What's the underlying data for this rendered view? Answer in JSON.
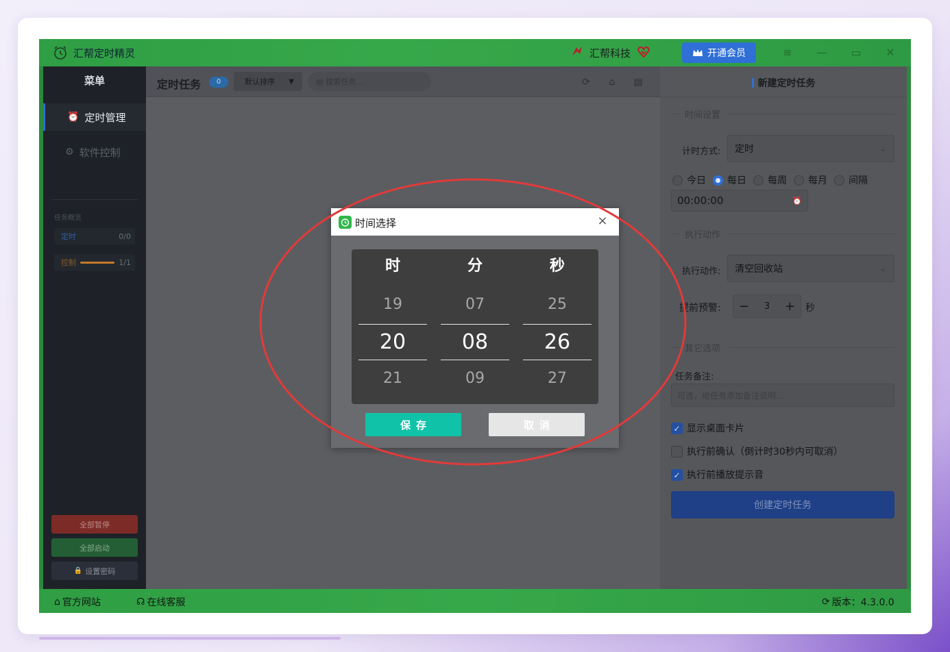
{
  "app": {
    "title": "汇帮定时精灵",
    "brand": "汇帮科技",
    "vip_label": "开通会员",
    "accent": "#2f6fd6",
    "titlebar_color": "#2f9e44"
  },
  "sidebar": {
    "menu_title": "菜单",
    "items": [
      {
        "label": "定时管理",
        "icon": "alarm-clock-icon",
        "active": true
      },
      {
        "label": "软件控制",
        "icon": "gear-icon",
        "active": false
      }
    ],
    "overview_title": "任务概览",
    "stats": [
      {
        "label": "定时",
        "value": "0/0",
        "color": "#2f6fd6"
      },
      {
        "label": "控制",
        "value": "1/1",
        "color": "#c77a2a"
      }
    ],
    "buttons": {
      "pause_all": "全部暂停",
      "start_all": "全部启动",
      "set_password": "设置密码"
    }
  },
  "middle": {
    "title": "定时任务",
    "count": "0",
    "sort_label": "默认排序",
    "search_placeholder": "搜索任务..."
  },
  "right": {
    "title": "新建定时任务",
    "time_section": "时间设置",
    "timing_mode_label": "计时方式:",
    "timing_mode_value": "定时",
    "radios": [
      {
        "label": "今日",
        "checked": false
      },
      {
        "label": "每日",
        "checked": true
      },
      {
        "label": "每周",
        "checked": false
      },
      {
        "label": "每月",
        "checked": false
      },
      {
        "label": "间隔",
        "checked": false
      }
    ],
    "time_value": "00:00:00",
    "action_section": "执行动作",
    "action_label": "执行动作:",
    "action_value": "清空回收站",
    "warn_label": "提前预警:",
    "warn_value": "3",
    "warn_unit": "秒",
    "other_section": "其它选项",
    "note_label": "任务备注:",
    "note_placeholder": "可选，给任务添加备注说明...",
    "checks": [
      {
        "label": "显示桌面卡片",
        "checked": true
      },
      {
        "label": "执行前确认（倒计时30秒内可取消）",
        "checked": false
      },
      {
        "label": "执行前播放提示音",
        "checked": true
      }
    ],
    "create_label": "创建定时任务"
  },
  "footer": {
    "website": "官方网站",
    "support": "在线客服",
    "version": "版本：4.3.0.0"
  },
  "modal": {
    "title": "时间选择",
    "columns": [
      {
        "head": "时",
        "prev": "19",
        "current": "20",
        "next": "21"
      },
      {
        "head": "分",
        "prev": "07",
        "current": "08",
        "next": "09"
      },
      {
        "head": "秒",
        "prev": "25",
        "current": "26",
        "next": "27"
      }
    ],
    "save_label": "保存",
    "cancel_label": "取消",
    "save_color": "#10c2a8"
  }
}
